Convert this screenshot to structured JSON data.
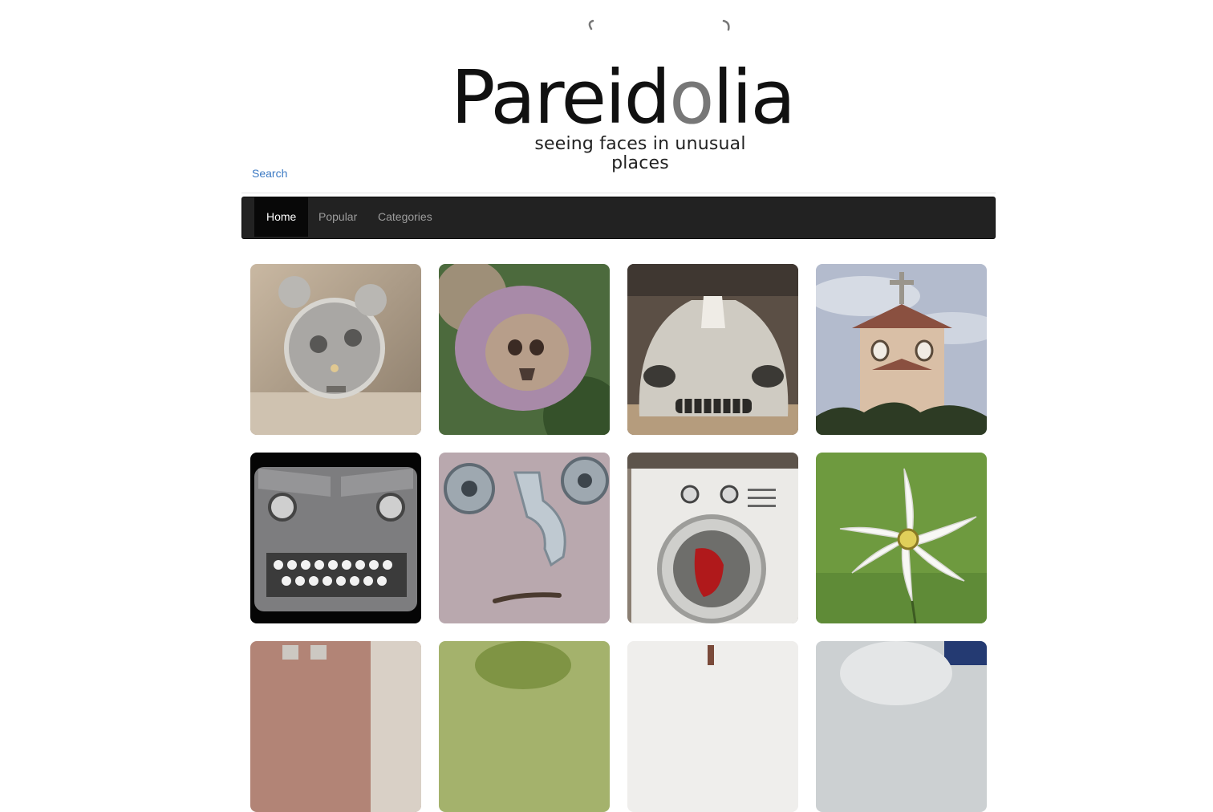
{
  "logo": {
    "title_main": "Pareid",
    "title_o": "o",
    "title_end": "lia",
    "tagline": "seeing faces in unusual places"
  },
  "search": {
    "label": "Search"
  },
  "nav": {
    "items": [
      {
        "label": "Home",
        "active": true
      },
      {
        "label": "Popular",
        "active": false
      },
      {
        "label": "Categories",
        "active": false
      }
    ]
  },
  "gallery": {
    "items": [
      {
        "subject": "alarm clock face",
        "icon": "alarm-clock"
      },
      {
        "subject": "skull shaped rose",
        "icon": "rose"
      },
      {
        "subject": "silver car front face",
        "icon": "car"
      },
      {
        "subject": "church face",
        "icon": "church"
      },
      {
        "subject": "typewriter face",
        "icon": "typewriter"
      },
      {
        "subject": "faucet face",
        "icon": "faucet"
      },
      {
        "subject": "washing machine face",
        "icon": "washing-machine"
      },
      {
        "subject": "white flower face",
        "icon": "flower"
      },
      {
        "subject": "brick building",
        "icon": "building"
      },
      {
        "subject": "green plant",
        "icon": "plant"
      },
      {
        "subject": "landscape",
        "icon": "landscape"
      },
      {
        "subject": "white object",
        "icon": "object"
      }
    ]
  },
  "colors": {
    "link": "#3b79c3",
    "navbar_bg": "#222222",
    "navbar_active": "#080808"
  }
}
